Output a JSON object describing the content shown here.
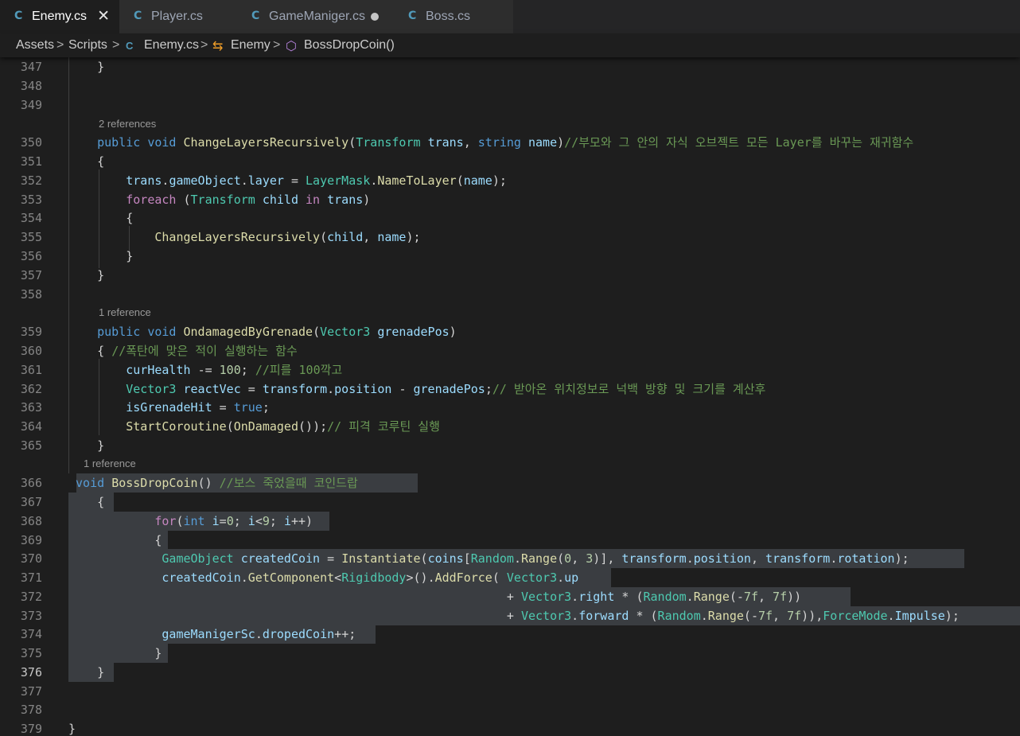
{
  "tabs": [
    {
      "label": "Enemy.cs",
      "active": true
    },
    {
      "label": "Player.cs",
      "active": false
    },
    {
      "label": "GameManiger.cs",
      "active": false,
      "modified": true
    },
    {
      "label": "Boss.cs",
      "active": false
    }
  ],
  "tab_close_glyph": "✕",
  "breadcrumb": {
    "assets": "Assets",
    "scripts": "Scripts",
    "file": "Enemy.cs",
    "class": "Enemy",
    "method": "BossDropCoin()",
    "separator": ">"
  },
  "code_lens": {
    "line350": "2 references",
    "line359": "1 reference",
    "line366": "1 reference"
  },
  "code_lines": [
    {
      "n": 347,
      "text": "    }"
    },
    {
      "n": 348,
      "text": ""
    },
    {
      "n": 349,
      "text": ""
    },
    {
      "n": 350,
      "text": "    public void ChangeLayersRecursively(Transform trans, string name)//부모와 그 안의 자식 오브젝트 모든 Layer를 바꾸는 재귀함수"
    },
    {
      "n": 351,
      "text": "    {"
    },
    {
      "n": 352,
      "text": "        trans.gameObject.layer = LayerMask.NameToLayer(name);"
    },
    {
      "n": 353,
      "text": "        foreach (Transform child in trans)"
    },
    {
      "n": 354,
      "text": "        {"
    },
    {
      "n": 355,
      "text": "            ChangeLayersRecursively(child, name);"
    },
    {
      "n": 356,
      "text": "        }"
    },
    {
      "n": 357,
      "text": "    }"
    },
    {
      "n": 358,
      "text": ""
    },
    {
      "n": 359,
      "text": "    public void OndamagedByGrenade(Vector3 grenadePos)"
    },
    {
      "n": 360,
      "text": "    { //폭탄에 맞은 적이 실행하는 함수"
    },
    {
      "n": 361,
      "text": "        curHealth -= 100; //피를 100깍고"
    },
    {
      "n": 362,
      "text": "        Vector3 reactVec = transform.position - grenadePos;// 받아온 위치정보로 넉백 방향 및 크기를 계산후"
    },
    {
      "n": 363,
      "text": "        isGrenadeHit = true;"
    },
    {
      "n": 364,
      "text": "        StartCoroutine(OnDamaged());// 피격 코루틴 실행"
    },
    {
      "n": 365,
      "text": "    }"
    },
    {
      "n": 366,
      "text": " void BossDropCoin() //보스 죽었을때 코인드랍"
    },
    {
      "n": 367,
      "text": "    {"
    },
    {
      "n": 368,
      "text": "            for(int i=0; i<9; i++)"
    },
    {
      "n": 369,
      "text": "            {"
    },
    {
      "n": 370,
      "text": "             GameObject createdCoin = Instantiate(coins[Random.Range(0, 3)], transform.position, transform.rotation);"
    },
    {
      "n": 371,
      "text": "             createdCoin.GetComponent<Rigidbody>().AddForce( Vector3.up"
    },
    {
      "n": 372,
      "text": "                                                             + Vector3.right * (Random.Range(-7f, 7f))"
    },
    {
      "n": 373,
      "text": "                                                             + Vector3.forward * (Random.Range(-7f, 7f)),ForceMode.Impulse);"
    },
    {
      "n": 374,
      "text": "             gameManigerSc.dropedCoin++;"
    },
    {
      "n": 375,
      "text": "            }"
    },
    {
      "n": 376,
      "text": "    }"
    },
    {
      "n": 377,
      "text": ""
    },
    {
      "n": 378,
      "text": ""
    },
    {
      "n": 379,
      "text": "}"
    }
  ],
  "current_line": 376,
  "colors": {
    "background": "#1e1e1e",
    "keyword": "#569cd6",
    "control": "#c586c0",
    "type": "#4ec9b0",
    "function": "#dcdcaa",
    "variable": "#9cdcfe",
    "number": "#b5cea8",
    "comment": "#6a9955",
    "selection": "#3a3d41"
  }
}
